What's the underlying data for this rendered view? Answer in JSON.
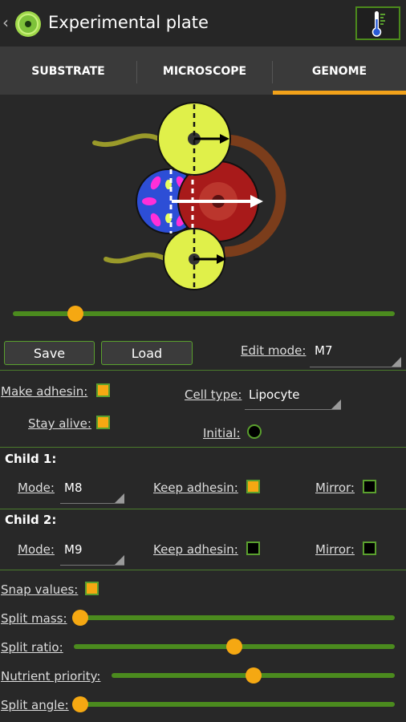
{
  "header": {
    "title": "Experimental plate",
    "back_icon": "chevron-left-icon",
    "logo_icon": "cell-logo-icon",
    "thermo_icon": "thermometer-icon"
  },
  "tabs": [
    {
      "label": "SUBSTRATE"
    },
    {
      "label": "MICROSCOPE"
    },
    {
      "label": "GENOME",
      "active": true
    }
  ],
  "preview": {
    "slider_value": 0.15
  },
  "actions": {
    "save_label": "Save",
    "load_label": "Load",
    "edit_mode_label": "Edit mode:",
    "edit_mode_value": "M7"
  },
  "mode": {
    "make_adhesin_label": "Make adhesin:",
    "make_adhesin": true,
    "stay_alive_label": "Stay alive:",
    "stay_alive": true,
    "cell_type_label": "Cell type:",
    "cell_type_value": "Lipocyte",
    "initial_label": "Initial:",
    "initial": false
  },
  "child1": {
    "title": "Child 1:",
    "mode_label": "Mode:",
    "mode_value": "M8",
    "keep_adhesin_label": "Keep adhesin:",
    "keep_adhesin": true,
    "mirror_label": "Mirror:",
    "mirror": false
  },
  "child2": {
    "title": "Child 2:",
    "mode_label": "Mode:",
    "mode_value": "M9",
    "keep_adhesin_label": "Keep adhesin:",
    "keep_adhesin": false,
    "mirror_label": "Mirror:",
    "mirror": false
  },
  "params": {
    "snap_values_label": "Snap values:",
    "snap_values": true,
    "split_mass_label": "Split mass:",
    "split_mass": 0.0,
    "split_ratio_label": "Split ratio:",
    "split_ratio": 0.5,
    "nutrient_priority_label": "Nutrient priority:",
    "nutrient_priority": 0.5,
    "split_angle_label": "Split angle:",
    "split_angle": 0.0
  },
  "colors": {
    "accent": "#f5a812",
    "green": "#5aa02e",
    "track": "#4b8b1e"
  }
}
